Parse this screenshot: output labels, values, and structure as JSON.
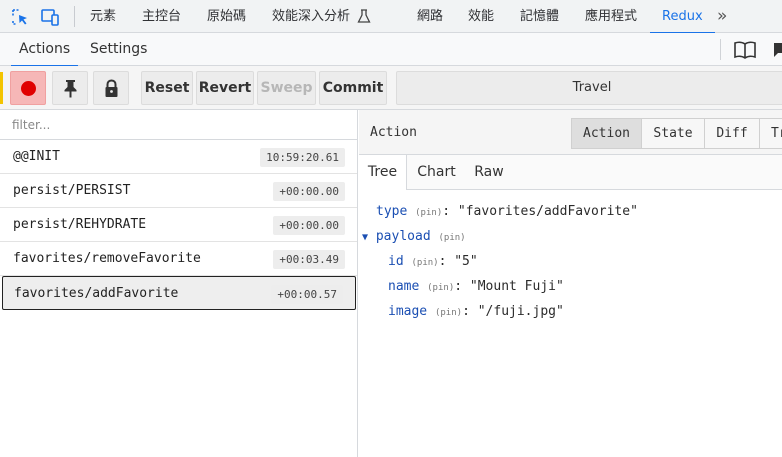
{
  "devtools_tabs": {
    "elements": "元素",
    "console": "主控台",
    "sources": "原始碼",
    "performance_insights": "效能深入分析",
    "network": "網路",
    "performance": "效能",
    "memory": "記憶體",
    "application": "應用程式",
    "redux": "Redux",
    "more": "»"
  },
  "subtabs": {
    "actions": "Actions",
    "settings": "Settings"
  },
  "toolbar": {
    "reset": "Reset",
    "revert": "Revert",
    "sweep": "Sweep",
    "commit": "Commit",
    "travel": "Travel",
    "icons": [
      "record-icon",
      "pin-icon",
      "lock-icon"
    ]
  },
  "filter": {
    "placeholder": "filter..."
  },
  "actions": [
    {
      "name": "@@INIT",
      "time": "10:59:20.61"
    },
    {
      "name": "persist/PERSIST",
      "time": "+00:00.00"
    },
    {
      "name": "persist/REHYDRATE",
      "time": "+00:00.00"
    },
    {
      "name": "favorites/removeFavorite",
      "time": "+00:03.49"
    },
    {
      "name": "favorites/addFavorite",
      "time": "+00:00.57",
      "selected": true
    }
  ],
  "inspector": {
    "title": "Action",
    "modes": [
      "Action",
      "State",
      "Diff",
      "Tr"
    ],
    "view_tabs": [
      "Tree",
      "Chart",
      "Raw"
    ],
    "tree": {
      "type_key": "type",
      "type_value": "\"favorites/addFavorite\"",
      "payload_key": "payload",
      "pin_label": "(pin)",
      "expand_arrow": "▼",
      "fields": [
        {
          "key": "id",
          "value": "\"5\""
        },
        {
          "key": "name",
          "value": "\"Mount Fuji\""
        },
        {
          "key": "image",
          "value": "\"/fuji.jpg\""
        }
      ]
    }
  },
  "colors": {
    "accent": "#1a73e8",
    "record": "#e00000",
    "tree_key": "#1b4fb3"
  }
}
